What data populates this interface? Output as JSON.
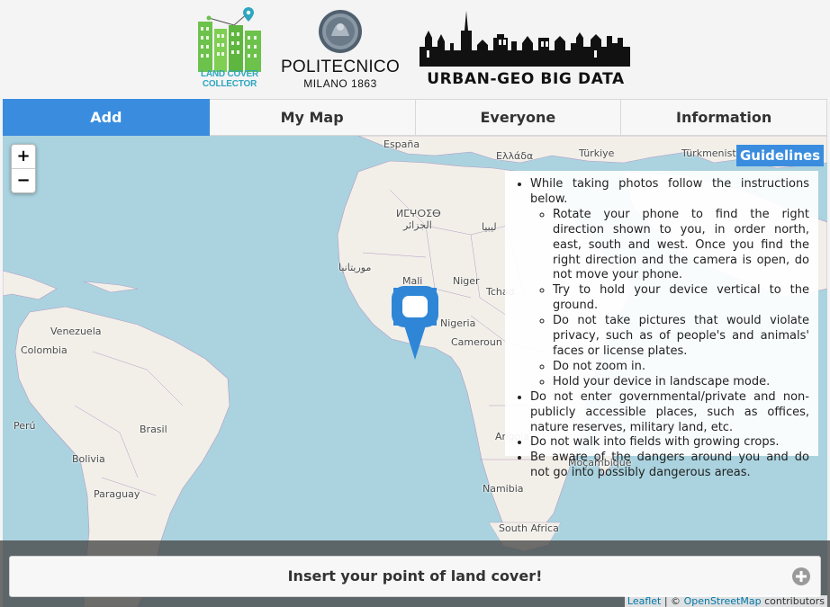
{
  "header": {
    "logo_lcc": {
      "line1": "LAND COVER",
      "line2": "COLLECTOR",
      "icon": "land-cover-collector-logo"
    },
    "logo_polimi": {
      "name": "POLITECNICO",
      "subtitle": "MILANO 1863",
      "icon": "politecnico-seal"
    },
    "logo_ugbd": {
      "name": "URBAN-GEO BIG DATA",
      "icon": "city-skyline-logo"
    }
  },
  "tabs": [
    {
      "label": "Add",
      "active": true
    },
    {
      "label": "My Map",
      "active": false
    },
    {
      "label": "Everyone",
      "active": false
    },
    {
      "label": "Information",
      "active": false
    }
  ],
  "map": {
    "zoom_in": "+",
    "zoom_out": "−",
    "labels": {
      "espana": "España",
      "turkiye": "Türkiye",
      "turkmenistan": "Türkmenistan",
      "ellada": "Ελλάδα",
      "amazigh": "ⵍⵎⵖⵔⵉⴱ",
      "algeria": "الجزائر",
      "libya": "ليبيا",
      "mauritania": "موريتانيا",
      "mali": "Mali",
      "niger": "Niger",
      "chad": "Tchad",
      "nigeria": "Nigeria",
      "cameroun": "Cameroun",
      "venezuela": "Venezuela",
      "colombia": "Colombia",
      "peru": "Perú",
      "brasil": "Brasil",
      "bolivia": "Bolivia",
      "paraguay": "Paraguay",
      "angola": "Angola",
      "mocambique": "Moçambique",
      "namibia": "Namibia",
      "south_africa": "South Africa"
    },
    "marker_icon": "location-pin-icon"
  },
  "guidelines": {
    "title": "Guidelines",
    "items": [
      "While taking photos follow the instructions below.",
      "Do not enter governmental/private and non-publicly accessible places, such as offices, nature reserves, military land, etc.",
      "Do not walk into fields with growing crops.",
      "Be aware of the dangers around you and do not go into possibly dangerous areas."
    ],
    "subitems": [
      "Rotate your phone to find the right direction shown to you, in order north, east, south and west. Once you find the right direction and the camera is open, do not move your phone.",
      "Try to hold your device vertical to the ground.",
      "Do not take pictures that would violate privacy, such as of people's and animals' faces or license plates.",
      "Do not zoom in.",
      "Hold your device in landscape mode."
    ]
  },
  "insert_button": {
    "label": "Insert your point of land cover!",
    "icon": "plus-circle-icon"
  },
  "attribution": {
    "leaflet": "Leaflet",
    "separator": "| ©",
    "osm": "OpenStreetMap",
    "suffix": "contributors"
  },
  "colors": {
    "accent": "#3a8dde",
    "sea": "#aad3df",
    "land": "#f2efe9",
    "lcc_green": "#6cc24a",
    "lcc_blue": "#2ea6c0"
  }
}
